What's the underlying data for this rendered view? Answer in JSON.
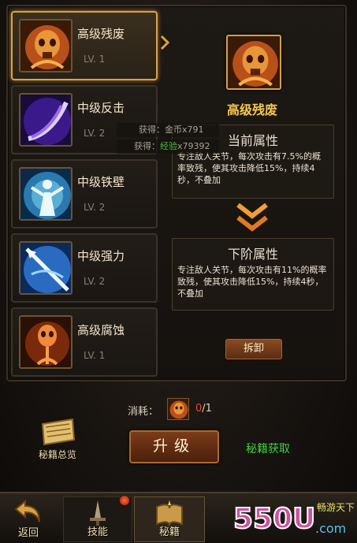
{
  "skills": [
    {
      "name": "高级残废",
      "level": "LV. 1",
      "icon": "flaming-skull-icon"
    },
    {
      "name": "中级反击",
      "level": "LV. 2",
      "icon": "purple-slash-icon"
    },
    {
      "name": "中级铁壁",
      "level": "LV. 2",
      "icon": "blue-aura-icon"
    },
    {
      "name": "中级强力",
      "level": "LV. 2",
      "icon": "spear-strike-icon"
    },
    {
      "name": "高级腐蚀",
      "level": "LV. 1",
      "icon": "corrosion-skull-icon"
    }
  ],
  "detail": {
    "title": "高级残废",
    "current_head": "当前属性",
    "current_body": "专注敌人关节，每次攻击有7.5%的概率致残，使其攻击降低15%，持续4秒，不叠加",
    "next_head": "下阶属性",
    "next_body": "专注敌人关节，每次攻击有11%的概率致残，使其攻击降低15%，持续4秒，不叠加",
    "unload": "拆卸"
  },
  "gains": [
    {
      "label": "获得：",
      "value": "金币x791"
    },
    {
      "label": "获得：",
      "value_green": "经验",
      "value": "x79392"
    }
  ],
  "cost": {
    "label": "消耗：",
    "current": "0",
    "total": "/1"
  },
  "actions": {
    "book_overview": "秘籍总览",
    "upgrade": "升级",
    "get_book": "秘籍获取"
  },
  "nav": {
    "back": "返回",
    "skill": "技能",
    "book": "秘籍"
  },
  "logo": {
    "main": "550U",
    "sub": "畅游天下",
    "tld": ".com"
  },
  "colors": {
    "gold": "#f5c94e",
    "green_link": "#3fd23f",
    "red": "#e24a3a"
  }
}
